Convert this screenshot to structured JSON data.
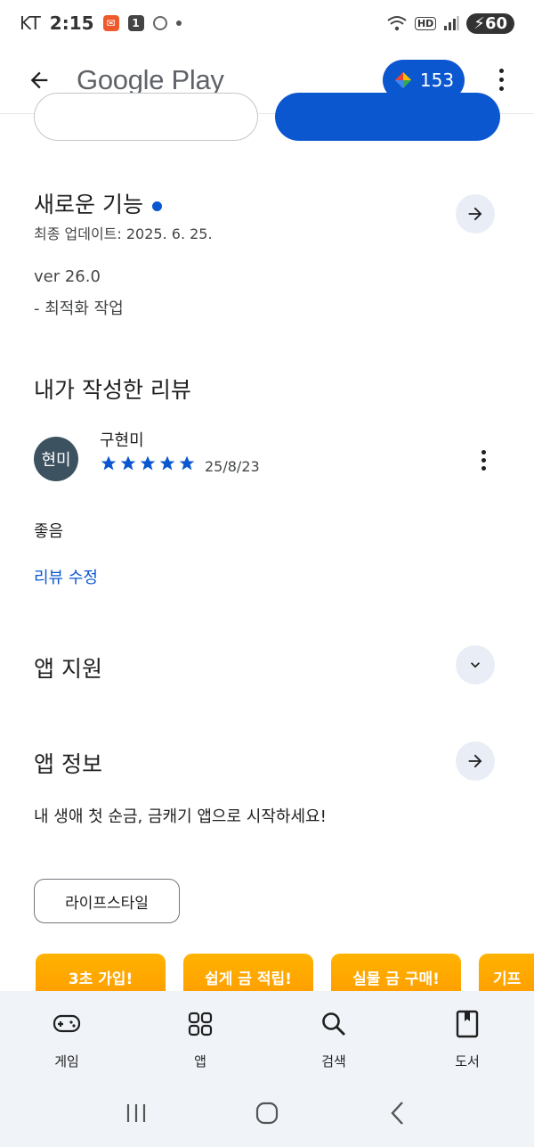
{
  "status_bar": {
    "carrier": "KT",
    "time": "2:15",
    "battery": "60"
  },
  "header": {
    "title": "Google Play",
    "points": "153"
  },
  "whats_new": {
    "title": "새로운 기능",
    "updated": "최종 업데이트: 2025. 6. 25.",
    "version": "ver 26.0",
    "note": "- 최적화 작업"
  },
  "my_review": {
    "title": "내가 작성한 리뷰",
    "avatar_text": "현미",
    "reviewer": "구현미",
    "rating": 5,
    "date": "25/8/23",
    "text": "좋음",
    "edit_label": "리뷰 수정"
  },
  "app_support": {
    "title": "앱 지원"
  },
  "app_info": {
    "title": "앱 정보",
    "description": "내 생애 첫 순금, 금캐기 앱으로 시작하세요!",
    "category": "라이프스타일"
  },
  "promos": [
    "3초 가입!",
    "쉽게 금 적립!",
    "실물 금 구매!",
    "기프티"
  ],
  "bottom_nav": [
    {
      "label": "게임",
      "icon": "gamepad-icon"
    },
    {
      "label": "앱",
      "icon": "apps-grid-icon"
    },
    {
      "label": "검색",
      "icon": "search-icon"
    },
    {
      "label": "도서",
      "icon": "book-icon"
    }
  ],
  "colors": {
    "accent": "#0b57d0",
    "promo": "#ffa000",
    "nav_bg": "#f0f4f9"
  }
}
